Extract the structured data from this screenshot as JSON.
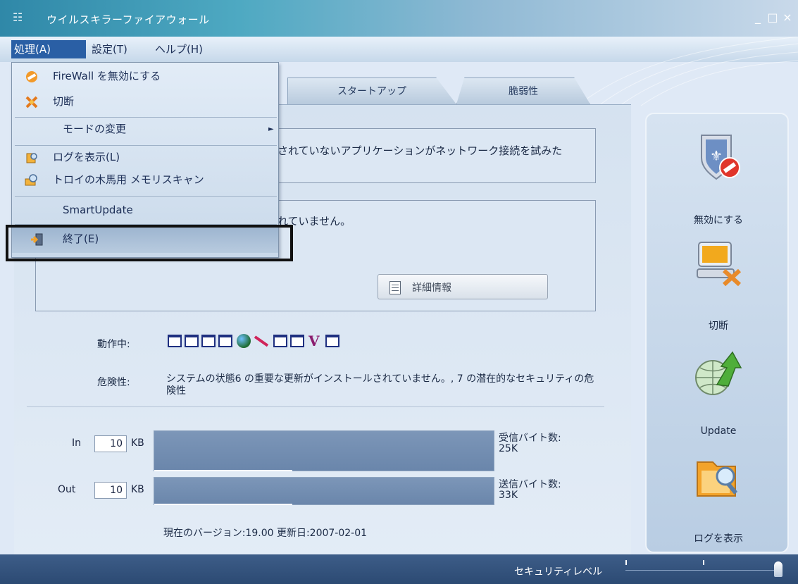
{
  "window": {
    "title": "ウイルスキラーファイアウォール",
    "controls": {
      "minimize": "_",
      "maximize": "□",
      "close": "×"
    }
  },
  "menubar": {
    "items": [
      {
        "label": "処理(A)"
      },
      {
        "label": "設定(T)"
      },
      {
        "label": "ヘルプ(H)"
      }
    ]
  },
  "tabs": [
    {
      "label": "スタートアップ"
    },
    {
      "label": "脆弱性"
    }
  ],
  "dropdown": {
    "items": [
      {
        "label": "FireWall を無効にする",
        "icon": "block-icon"
      },
      {
        "label": "切断",
        "icon": "disconnect-icon"
      },
      {
        "label": "モードの変更",
        "icon": "",
        "submenu_arrow": "►"
      },
      {
        "label": "ログを表示(L)",
        "icon": "log-icon"
      },
      {
        "label": "トロイの木馬用 メモリスキャン",
        "icon": "scan-icon"
      },
      {
        "label": "SmartUpdate",
        "icon": ""
      },
      {
        "label": "終了(E)",
        "icon": "exit-icon"
      }
    ]
  },
  "main": {
    "box1_text": "されていないアプリケーションがネットワーク接続を試みた",
    "box2_text": "れていません。",
    "detail_button": "詳細情報",
    "running_label": "動作中:",
    "risk_label": "危険性:",
    "risk_text": "システムの状態6 の重要な更新がインストールされていません。, 7 の潜在的なセキュリティの危険性",
    "in_label": "In",
    "out_label": "Out",
    "in_value": "10",
    "out_value": "10",
    "unit": "KB",
    "received_label": "受信バイト数:",
    "received_value": "25K",
    "sent_label": "送信バイト数:",
    "sent_value": "33K",
    "version_text": "現在のバージョン:19.00  更新日:2007-02-01"
  },
  "sidebar": {
    "items": [
      {
        "label": "無効にする",
        "icon": "shield-block-icon"
      },
      {
        "label": "切断",
        "icon": "disconnect-computer-icon"
      },
      {
        "label": "Update",
        "icon": "update-globe-icon"
      },
      {
        "label": "ログを表示",
        "icon": "log-folder-icon"
      }
    ]
  },
  "statusbar": {
    "security_level_label": "セキュリティレベル"
  },
  "colors": {
    "title_gradient_start": "#2f88a8",
    "menu_active": "#2a5fa5",
    "status_bar": "#2c4a73",
    "panel_bg": "#dce7f3"
  }
}
